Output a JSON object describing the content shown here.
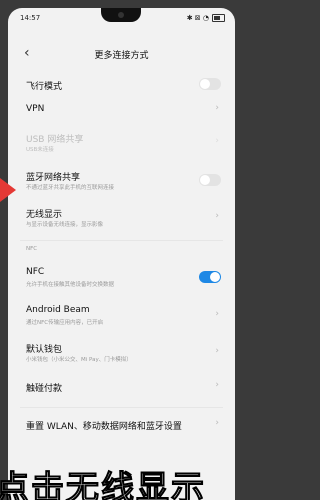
{
  "status": {
    "time": "14:57",
    "right_icons": "✱ ⊠ ◔"
  },
  "header": {
    "back_icon": "‹",
    "title": "更多连接方式"
  },
  "items": {
    "airplane": {
      "label": "飞行模式"
    },
    "vpn": {
      "label": "VPN"
    },
    "usb": {
      "label": "USB 网络共享",
      "sub": "USB未连接"
    },
    "bt_share": {
      "label": "蓝牙网络共享",
      "sub": "不通过蓝牙共享此手机的互联网连接"
    },
    "wireless": {
      "label": "无线显示",
      "sub": "与显示设备无线连接，显示影像"
    },
    "nfc_header": "NFC",
    "nfc": {
      "label": "NFC",
      "sub": "允许手机在接触其他设备时交换数据"
    },
    "beam": {
      "label": "Android Beam",
      "sub": "通过NFC传输应用内容，已开启"
    },
    "wallet": {
      "label": "默认钱包",
      "sub": "小米钱包（小米公交、Mi Pay、门卡模拟）"
    },
    "tap_pay": {
      "label": "触碰付款"
    },
    "reset": {
      "label": "重置 WLAN、移动数据网络和蓝牙设置"
    }
  },
  "chevron": "›",
  "caption": "点击无线显示",
  "colors": {
    "accent": "#1e88e5",
    "pointer": "#e53935"
  }
}
